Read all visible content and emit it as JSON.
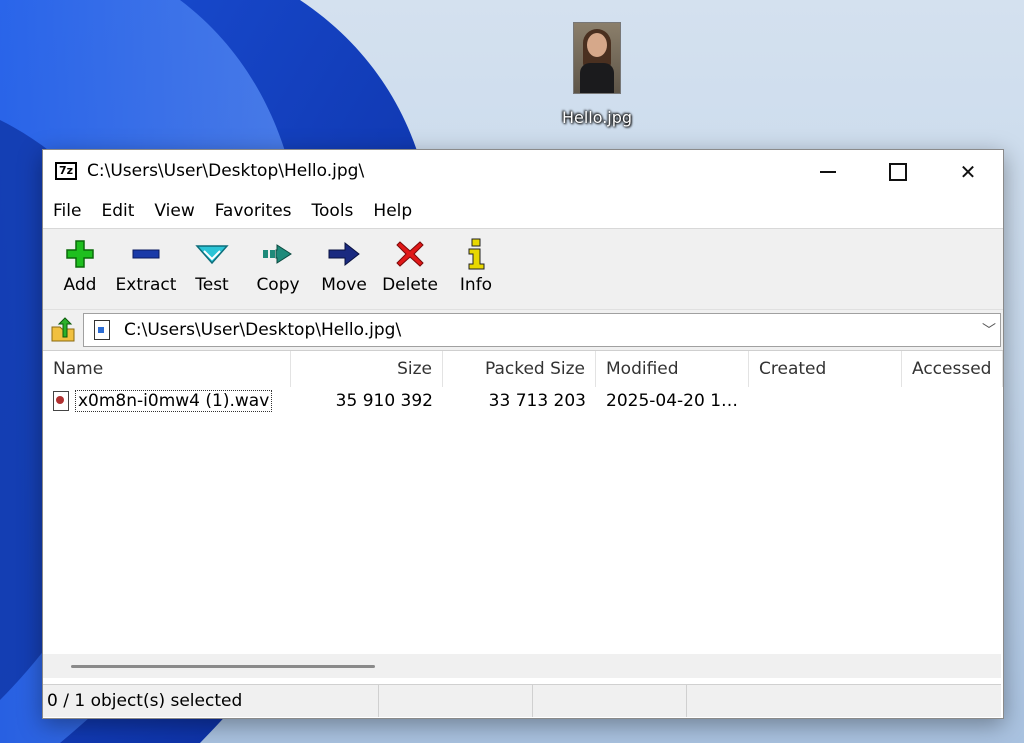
{
  "desktop": {
    "icon_label": "Hello.jpg"
  },
  "window": {
    "title": "C:\\Users\\User\\Desktop\\Hello.jpg\\",
    "app_icon_text": "7z"
  },
  "menu": [
    "File",
    "Edit",
    "View",
    "Favorites",
    "Tools",
    "Help"
  ],
  "toolbar": [
    {
      "label": "Add",
      "icon": "add-icon"
    },
    {
      "label": "Extract",
      "icon": "extract-icon"
    },
    {
      "label": "Test",
      "icon": "test-icon"
    },
    {
      "label": "Copy",
      "icon": "copy-icon"
    },
    {
      "label": "Move",
      "icon": "move-icon"
    },
    {
      "label": "Delete",
      "icon": "delete-icon"
    },
    {
      "label": "Info",
      "icon": "info-icon"
    }
  ],
  "address": {
    "value": "C:\\Users\\User\\Desktop\\Hello.jpg\\"
  },
  "columns": [
    "Name",
    "Size",
    "Packed Size",
    "Modified",
    "Created",
    "Accessed"
  ],
  "rows": [
    {
      "name": "x0m8n-i0mw4 (1).wav",
      "size": "35 910 392",
      "packed": "33 713 203",
      "modified": "2025-04-20 1…",
      "created": "",
      "accessed": ""
    }
  ],
  "status": {
    "selected": "0 / 1 object(s) selected"
  },
  "colors": {
    "add": "#1fbf1f",
    "extract": "#1a3aa8",
    "test": "#2bc4d6",
    "copy": "#1e8a7a",
    "move": "#1a2a80",
    "delete": "#e01818",
    "info": "#e8d800"
  }
}
